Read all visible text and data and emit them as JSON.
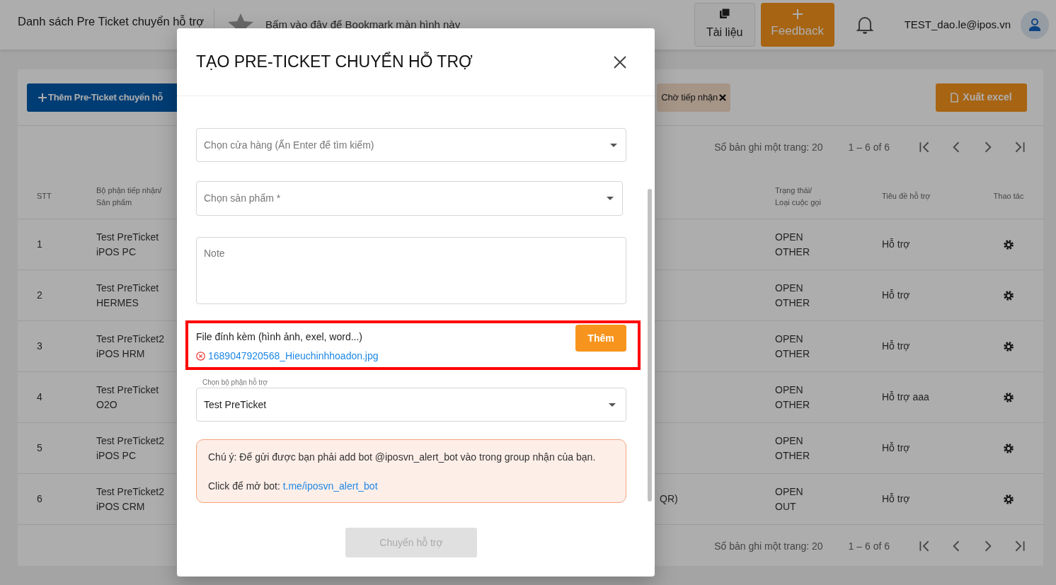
{
  "header": {
    "title": "Danh sách Pre Ticket chuyển hỗ trợ",
    "bookmark_text": "Bấm vào đây để Bookmark màn hình này",
    "docs_button": "Tài liệu",
    "feedback_button": "Feedback",
    "user_email": "TEST_dao.le@ipos.vn"
  },
  "toolbar": {
    "add_button": "Thêm Pre-Ticket chuyển hỗ",
    "filter_chip": "Chờ tiếp nhận",
    "export_button": "Xuất excel"
  },
  "pagination_top": {
    "page_size_label": "Số bản ghi một trang: 20",
    "range": "1 – 6 of 6"
  },
  "table": {
    "columns": [
      {
        "lines": [
          "STT"
        ]
      },
      {
        "lines": [
          "Bộ phận tiếp nhận/",
          "Sản phẩm"
        ]
      },
      {},
      {
        "lines": [
          "Trạng thái/",
          "Loại cuộc gọi"
        ]
      },
      {
        "lines": [
          "Tiêu đề hỗ trợ"
        ]
      },
      {
        "lines": [
          "Thao tác"
        ]
      }
    ],
    "rows": [
      {
        "stt": "1",
        "department": [
          "Test PreTicket",
          "iPOS PC"
        ],
        "status": [
          "OPEN",
          "OTHER"
        ],
        "title": "Hỗ trợ"
      },
      {
        "stt": "2",
        "department": [
          "Test PreTicket",
          "HERMES"
        ],
        "status": [
          "OPEN",
          "OTHER"
        ],
        "title": "Hỗ trợ"
      },
      {
        "stt": "3",
        "department": [
          "Test PreTicket2",
          "iPOS HRM"
        ],
        "status": [
          "OPEN",
          "OTHER"
        ],
        "title": "Hỗ trợ"
      },
      {
        "stt": "4",
        "department": [
          "Test PreTicket",
          "O2O"
        ],
        "status": [
          "OPEN",
          "OTHER"
        ],
        "title": "Hỗ trợ aaa"
      },
      {
        "stt": "5",
        "department": [
          "Test PreTicket2",
          "iPOS PC"
        ],
        "status": [
          "OPEN",
          "OTHER"
        ],
        "title": "Hỗ trợ"
      },
      {
        "stt": "6",
        "department": [
          "Test PreTicket2",
          "iPOS CRM"
        ],
        "column_3": "QR)",
        "status": [
          "OPEN",
          "OUT"
        ],
        "title": "Hỗ trợ"
      }
    ]
  },
  "pagination_bottom": {
    "page_size_label": "Số bản ghi một trang: 20",
    "range": "1 – 6 of 6"
  },
  "modal": {
    "title": "TẠO PRE-TICKET CHUYỂN HỖ TRỢ",
    "store_select": {
      "placeholder": "Chọn cửa hàng (Ấn Enter để tìm kiếm)"
    },
    "product_select": {
      "placeholder": "Chọn sản phẩm *"
    },
    "note": {
      "placeholder": "Note"
    },
    "attachments": {
      "label": "File đính kèm (hình ảnh, exel, word...)",
      "add_button": "Thêm",
      "files": [
        "1689047920568_Hieuchinhhoadon.jpg"
      ]
    },
    "support_select": {
      "label": "Chọn bộ phận hỗ trợ",
      "value": "Test PreTicket"
    },
    "notice": {
      "text": "Chú ý: Để gửi được bạn phải add bot @iposvn_alert_bot vào trong group nhận của bạn.",
      "link_prefix": "Click để mở bot:",
      "link": "t.me/iposvn_alert_bot"
    },
    "submit": {
      "label": "Chuyển hỗ trợ",
      "disabled": true
    }
  }
}
